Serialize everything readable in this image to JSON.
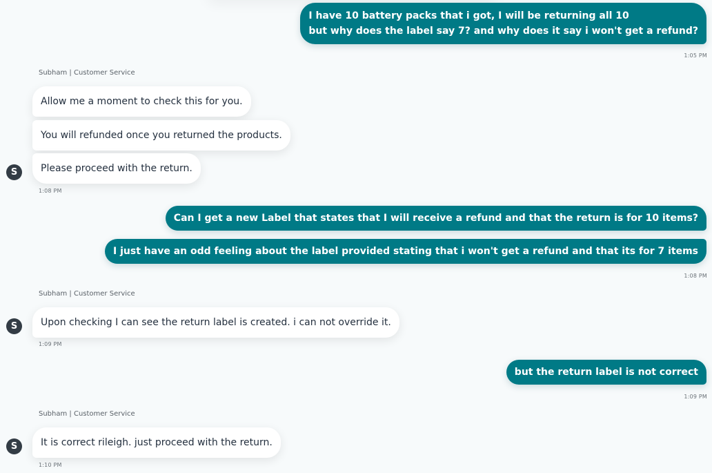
{
  "conversation": {
    "messages": [
      {
        "from": "customer",
        "lines": [
          "I have 10 battery packs that i got, I will be returning all 10",
          "but why does the label say 7? and why does it say i won't get a refund?"
        ],
        "time": "1:05 PM"
      },
      {
        "from": "agent",
        "sender": "Subham | Customer Service",
        "avatar": "S",
        "bubbles": [
          "Allow me a moment to check this for you.",
          "You will refunded once you returned the products.",
          "Please proceed with the return."
        ],
        "time": "1:08 PM"
      },
      {
        "from": "customer",
        "bubbles": [
          "Can I get a new Label that states that I will receive a refund and that the return is for 10 items?",
          "I just have an odd feeling about the label provided stating that i won't get a refund and that its for 7 items"
        ],
        "time": "1:08 PM"
      },
      {
        "from": "agent",
        "sender": "Subham | Customer Service",
        "avatar": "S",
        "bubbles": [
          "Upon checking I can see the return label is created. i can not override it."
        ],
        "time": "1:09 PM"
      },
      {
        "from": "customer",
        "bubbles": [
          "but the return label is not correct"
        ],
        "time": "1:09 PM"
      },
      {
        "from": "agent",
        "sender": "Subham | Customer Service",
        "avatar": "S",
        "bubbles": [
          "It is correct rileigh. just proceed with the return."
        ],
        "time": "1:10 PM"
      }
    ]
  },
  "colors": {
    "customer_bubble": "#007a86",
    "agent_bubble": "#ffffff",
    "background": "#f7fafb",
    "avatar": "#333c45"
  }
}
